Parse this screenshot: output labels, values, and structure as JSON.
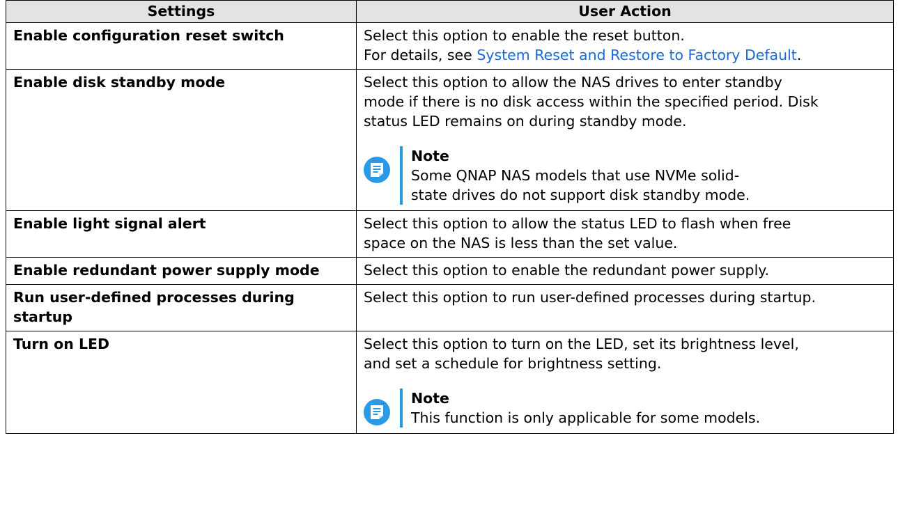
{
  "table": {
    "headers": {
      "settings": "Settings",
      "user_action": "User Action"
    },
    "rows": [
      {
        "setting": "Enable configuration reset switch",
        "lines": [
          "Select this option to enable the reset button."
        ],
        "line2_prefix": "For details, see ",
        "link": "System Reset and Restore to Factory Default",
        "line2_suffix": "."
      },
      {
        "setting": "Enable disk standby mode",
        "lines": [
          "Select this option to allow the NAS drives to enter standby",
          "mode if there is no disk access within the specified period. Disk",
          "status LED remains on during standby mode."
        ],
        "note": {
          "title": "Note",
          "lines": [
            "Some QNAP NAS models that use NVMe solid-",
            "state drives do not support disk standby mode."
          ]
        }
      },
      {
        "setting": "Enable light signal alert",
        "lines": [
          "Select this option to allow the status LED to flash when free",
          "space on the NAS is less than the set value."
        ]
      },
      {
        "setting": "Enable redundant power supply mode",
        "lines": [
          "Select this option to enable the redundant power supply."
        ]
      },
      {
        "setting_lines": [
          "Run user-defined processes during",
          "startup"
        ],
        "lines": [
          "Select this option to run user-defined processes during startup."
        ]
      },
      {
        "setting": "Turn on LED",
        "lines": [
          "Select this option to turn on the LED, set its brightness level,",
          "and set a schedule for brightness setting."
        ],
        "note": {
          "title": "Note",
          "lines": [
            "This function is only applicable for some models."
          ]
        }
      }
    ]
  },
  "colors": {
    "link": "#1b6ad8",
    "note_accent": "#2b9ae6",
    "header_bg": "#e3e3e3"
  },
  "icons": {
    "note": "note-icon"
  }
}
